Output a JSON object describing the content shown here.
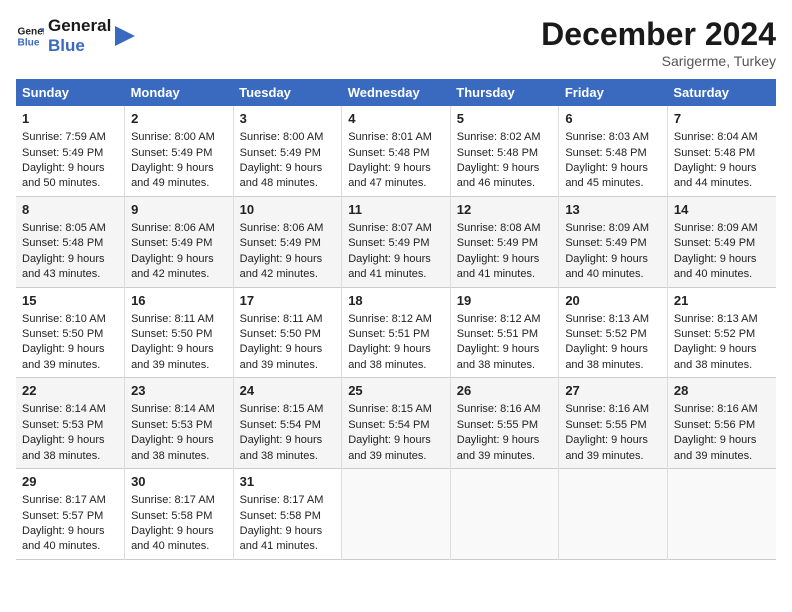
{
  "logo": {
    "line1": "General",
    "line2": "Blue"
  },
  "title": "December 2024",
  "subtitle": "Sarigerme, Turkey",
  "headers": [
    "Sunday",
    "Monday",
    "Tuesday",
    "Wednesday",
    "Thursday",
    "Friday",
    "Saturday"
  ],
  "weeks": [
    [
      {
        "day": "1",
        "lines": [
          "Sunrise: 7:59 AM",
          "Sunset: 5:49 PM",
          "Daylight: 9 hours",
          "and 50 minutes."
        ]
      },
      {
        "day": "2",
        "lines": [
          "Sunrise: 8:00 AM",
          "Sunset: 5:49 PM",
          "Daylight: 9 hours",
          "and 49 minutes."
        ]
      },
      {
        "day": "3",
        "lines": [
          "Sunrise: 8:00 AM",
          "Sunset: 5:49 PM",
          "Daylight: 9 hours",
          "and 48 minutes."
        ]
      },
      {
        "day": "4",
        "lines": [
          "Sunrise: 8:01 AM",
          "Sunset: 5:48 PM",
          "Daylight: 9 hours",
          "and 47 minutes."
        ]
      },
      {
        "day": "5",
        "lines": [
          "Sunrise: 8:02 AM",
          "Sunset: 5:48 PM",
          "Daylight: 9 hours",
          "and 46 minutes."
        ]
      },
      {
        "day": "6",
        "lines": [
          "Sunrise: 8:03 AM",
          "Sunset: 5:48 PM",
          "Daylight: 9 hours",
          "and 45 minutes."
        ]
      },
      {
        "day": "7",
        "lines": [
          "Sunrise: 8:04 AM",
          "Sunset: 5:48 PM",
          "Daylight: 9 hours",
          "and 44 minutes."
        ]
      }
    ],
    [
      {
        "day": "8",
        "lines": [
          "Sunrise: 8:05 AM",
          "Sunset: 5:48 PM",
          "Daylight: 9 hours",
          "and 43 minutes."
        ]
      },
      {
        "day": "9",
        "lines": [
          "Sunrise: 8:06 AM",
          "Sunset: 5:49 PM",
          "Daylight: 9 hours",
          "and 42 minutes."
        ]
      },
      {
        "day": "10",
        "lines": [
          "Sunrise: 8:06 AM",
          "Sunset: 5:49 PM",
          "Daylight: 9 hours",
          "and 42 minutes."
        ]
      },
      {
        "day": "11",
        "lines": [
          "Sunrise: 8:07 AM",
          "Sunset: 5:49 PM",
          "Daylight: 9 hours",
          "and 41 minutes."
        ]
      },
      {
        "day": "12",
        "lines": [
          "Sunrise: 8:08 AM",
          "Sunset: 5:49 PM",
          "Daylight: 9 hours",
          "and 41 minutes."
        ]
      },
      {
        "day": "13",
        "lines": [
          "Sunrise: 8:09 AM",
          "Sunset: 5:49 PM",
          "Daylight: 9 hours",
          "and 40 minutes."
        ]
      },
      {
        "day": "14",
        "lines": [
          "Sunrise: 8:09 AM",
          "Sunset: 5:49 PM",
          "Daylight: 9 hours",
          "and 40 minutes."
        ]
      }
    ],
    [
      {
        "day": "15",
        "lines": [
          "Sunrise: 8:10 AM",
          "Sunset: 5:50 PM",
          "Daylight: 9 hours",
          "and 39 minutes."
        ]
      },
      {
        "day": "16",
        "lines": [
          "Sunrise: 8:11 AM",
          "Sunset: 5:50 PM",
          "Daylight: 9 hours",
          "and 39 minutes."
        ]
      },
      {
        "day": "17",
        "lines": [
          "Sunrise: 8:11 AM",
          "Sunset: 5:50 PM",
          "Daylight: 9 hours",
          "and 39 minutes."
        ]
      },
      {
        "day": "18",
        "lines": [
          "Sunrise: 8:12 AM",
          "Sunset: 5:51 PM",
          "Daylight: 9 hours",
          "and 38 minutes."
        ]
      },
      {
        "day": "19",
        "lines": [
          "Sunrise: 8:12 AM",
          "Sunset: 5:51 PM",
          "Daylight: 9 hours",
          "and 38 minutes."
        ]
      },
      {
        "day": "20",
        "lines": [
          "Sunrise: 8:13 AM",
          "Sunset: 5:52 PM",
          "Daylight: 9 hours",
          "and 38 minutes."
        ]
      },
      {
        "day": "21",
        "lines": [
          "Sunrise: 8:13 AM",
          "Sunset: 5:52 PM",
          "Daylight: 9 hours",
          "and 38 minutes."
        ]
      }
    ],
    [
      {
        "day": "22",
        "lines": [
          "Sunrise: 8:14 AM",
          "Sunset: 5:53 PM",
          "Daylight: 9 hours",
          "and 38 minutes."
        ]
      },
      {
        "day": "23",
        "lines": [
          "Sunrise: 8:14 AM",
          "Sunset: 5:53 PM",
          "Daylight: 9 hours",
          "and 38 minutes."
        ]
      },
      {
        "day": "24",
        "lines": [
          "Sunrise: 8:15 AM",
          "Sunset: 5:54 PM",
          "Daylight: 9 hours",
          "and 38 minutes."
        ]
      },
      {
        "day": "25",
        "lines": [
          "Sunrise: 8:15 AM",
          "Sunset: 5:54 PM",
          "Daylight: 9 hours",
          "and 39 minutes."
        ]
      },
      {
        "day": "26",
        "lines": [
          "Sunrise: 8:16 AM",
          "Sunset: 5:55 PM",
          "Daylight: 9 hours",
          "and 39 minutes."
        ]
      },
      {
        "day": "27",
        "lines": [
          "Sunrise: 8:16 AM",
          "Sunset: 5:55 PM",
          "Daylight: 9 hours",
          "and 39 minutes."
        ]
      },
      {
        "day": "28",
        "lines": [
          "Sunrise: 8:16 AM",
          "Sunset: 5:56 PM",
          "Daylight: 9 hours",
          "and 39 minutes."
        ]
      }
    ],
    [
      {
        "day": "29",
        "lines": [
          "Sunrise: 8:17 AM",
          "Sunset: 5:57 PM",
          "Daylight: 9 hours",
          "and 40 minutes."
        ]
      },
      {
        "day": "30",
        "lines": [
          "Sunrise: 8:17 AM",
          "Sunset: 5:58 PM",
          "Daylight: 9 hours",
          "and 40 minutes."
        ]
      },
      {
        "day": "31",
        "lines": [
          "Sunrise: 8:17 AM",
          "Sunset: 5:58 PM",
          "Daylight: 9 hours",
          "and 41 minutes."
        ]
      },
      null,
      null,
      null,
      null
    ]
  ]
}
